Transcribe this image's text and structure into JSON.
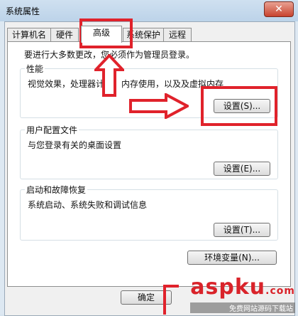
{
  "window": {
    "title": "系统属性",
    "close_glyph": "✕"
  },
  "tabs": [
    {
      "label": "计算机名"
    },
    {
      "label": "硬件"
    },
    {
      "label": "高级",
      "active": true
    },
    {
      "label": "系统保护"
    },
    {
      "label": "远程"
    }
  ],
  "notice": "要进行大多数更改，您必须作为管理员登录。",
  "performance": {
    "title": "性能",
    "desc": "视觉效果，处理器计划，内存使用，以及及虚拟内存",
    "button": "设置(S)..."
  },
  "user_profiles": {
    "title": "用户配置文件",
    "desc": "与您登录有关的桌面设置",
    "button": "设置(E)..."
  },
  "startup": {
    "title": "启动和故障恢复",
    "desc": "系统启动、系统失败和调试信息",
    "button": "设置(T)..."
  },
  "env_button": "环境变量(N)...",
  "ok_button": "确定",
  "watermark": {
    "main": "aspku",
    "suffix": ".com",
    "sub": "免费网站源码下载站"
  },
  "colors": {
    "annotation_red": "#e0222b"
  }
}
